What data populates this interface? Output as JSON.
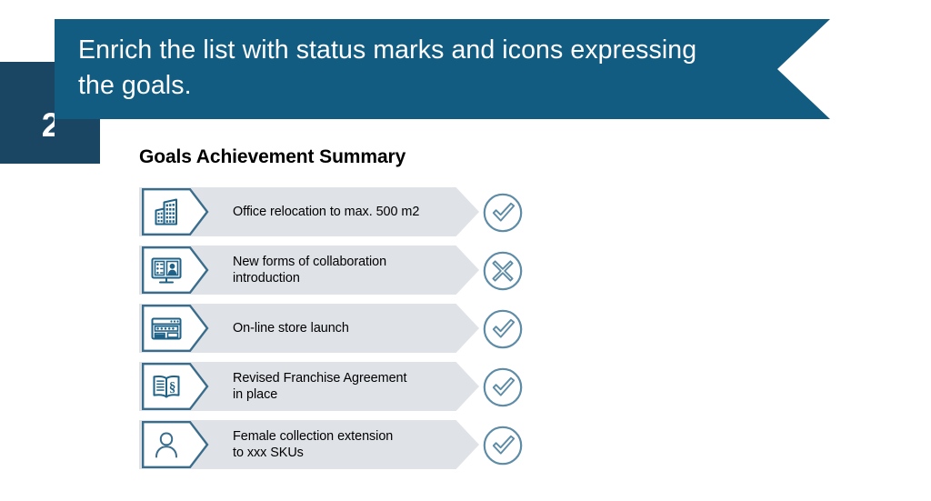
{
  "colors": {
    "banner_blue": "#125C82",
    "dark_navy": "#1A4663",
    "panel_gray": "#DFE2E7",
    "icon_blue": "#1F6287",
    "status_blue_gray": "#5E8CA6",
    "text_black": "#000000",
    "white": "#FFFFFF"
  },
  "header": {
    "step_number": "2",
    "title": "Enrich the list with status marks and icons expressing\nthe goals."
  },
  "main": {
    "section_title": "Goals Achievement Summary",
    "goals": [
      {
        "label": "Office relocation to max. 500 m2",
        "icon": "office-building-icon",
        "status": "check-circle-icon",
        "status_label": "achieved"
      },
      {
        "label": "New forms of collaboration\nintroduction",
        "icon": "video-conference-monitor-icon",
        "status": "cross-circle-icon",
        "status_label": "not-achieved"
      },
      {
        "label": "On-line store launch",
        "icon": "browser-window-icon",
        "status": "check-circle-icon",
        "status_label": "achieved"
      },
      {
        "label": "Revised Franchise Agreement\nin place",
        "icon": "open-book-section-icon",
        "status": "check-circle-icon",
        "status_label": "achieved"
      },
      {
        "label": "Female collection extension\nto xxx SKUs",
        "icon": "person-icon",
        "status": "check-circle-icon",
        "status_label": "achieved"
      }
    ]
  }
}
